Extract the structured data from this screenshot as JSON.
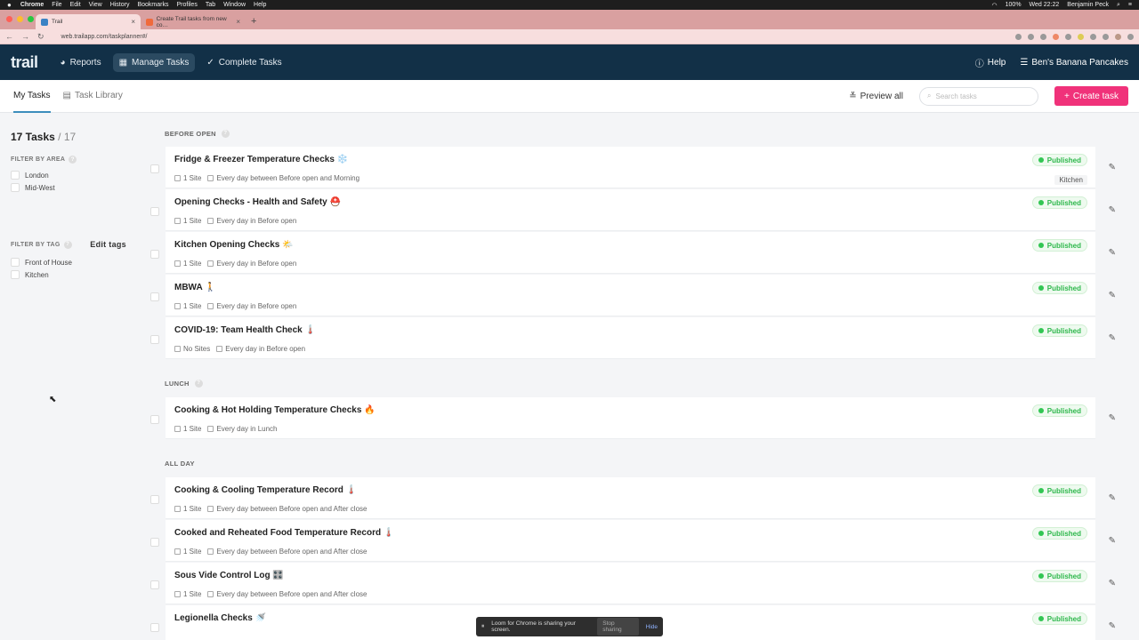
{
  "mac_menu": {
    "apple": "",
    "items": [
      "Chrome",
      "File",
      "Edit",
      "View",
      "History",
      "Bookmarks",
      "Profiles",
      "Tab",
      "Window",
      "Help"
    ],
    "battery": "100%",
    "clock": "Wed 22:22",
    "user": "Benjamin Peck"
  },
  "browser": {
    "tabs": [
      {
        "title": "Trail",
        "active": true
      },
      {
        "title": "Create Trail tasks from new co…",
        "active": false
      }
    ],
    "url": "web.trailapp.com/taskplanner#/"
  },
  "app": {
    "logo": "trail",
    "nav": [
      {
        "label": "Reports",
        "icon": "pie-chart-icon",
        "active": false
      },
      {
        "label": "Manage Tasks",
        "icon": "calendar-icon",
        "active": true
      },
      {
        "label": "Complete Tasks",
        "icon": "check-icon",
        "active": false
      }
    ],
    "help": "Help",
    "account": "Ben's Banana Pancakes"
  },
  "subnav": {
    "tabs": [
      {
        "label": "My Tasks",
        "active": true
      },
      {
        "label": "Task Library",
        "active": false
      }
    ],
    "preview_all": "Preview all",
    "search_placeholder": "Search tasks",
    "create_task": "Create task"
  },
  "sidebar": {
    "count": "17 Tasks",
    "total": " / 17",
    "filter_area_title": "FILTER BY AREA",
    "areas": [
      "London",
      "Mid-West"
    ],
    "filter_tag_title": "FILTER BY TAG",
    "edit_tags": "Edit tags",
    "tags": [
      "Front of House",
      "Kitchen"
    ]
  },
  "sections": [
    {
      "title": "BEFORE OPEN",
      "tasks": [
        {
          "name": "Fridge & Freezer Temperature Checks ❄️",
          "sites": "1 Site",
          "schedule": "Every day between Before open and Morning",
          "status": "Published",
          "tag": "Kitchen"
        },
        {
          "name": "Opening Checks - Health and Safety ⛑️",
          "sites": "1 Site",
          "schedule": "Every day in Before open",
          "status": "Published",
          "tag": ""
        },
        {
          "name": "Kitchen Opening Checks 🌤️",
          "sites": "1 Site",
          "schedule": "Every day in Before open",
          "status": "Published",
          "tag": ""
        },
        {
          "name": "MBWA 🚶",
          "sites": "1 Site",
          "schedule": "Every day in Before open",
          "status": "Published",
          "tag": ""
        },
        {
          "name": "COVID-19: Team Health Check 🌡️",
          "sites": "No Sites",
          "schedule": "Every day in Before open",
          "status": "Published",
          "tag": ""
        }
      ]
    },
    {
      "title": "LUNCH",
      "tasks": [
        {
          "name": "Cooking & Hot Holding Temperature Checks 🔥",
          "sites": "1 Site",
          "schedule": "Every day in Lunch",
          "status": "Published",
          "tag": ""
        }
      ]
    },
    {
      "title": "ALL DAY",
      "tasks": [
        {
          "name": "Cooking & Cooling Temperature Record 🌡️",
          "sites": "1 Site",
          "schedule": "Every day between Before open and After close",
          "status": "Published",
          "tag": ""
        },
        {
          "name": "Cooked and Reheated Food Temperature Record 🌡️",
          "sites": "1 Site",
          "schedule": "Every day between Before open and After close",
          "status": "Published",
          "tag": ""
        },
        {
          "name": "Sous Vide Control Log 🎛️",
          "sites": "1 Site",
          "schedule": "Every day between Before open and After close",
          "status": "Published",
          "tag": ""
        },
        {
          "name": "Legionella Checks 🚿",
          "sites": "",
          "schedule": "",
          "status": "Published",
          "tag": ""
        }
      ]
    }
  ],
  "loom": {
    "message": "Loom for Chrome is sharing your screen.",
    "stop": "Stop sharing",
    "hide": "Hide"
  }
}
